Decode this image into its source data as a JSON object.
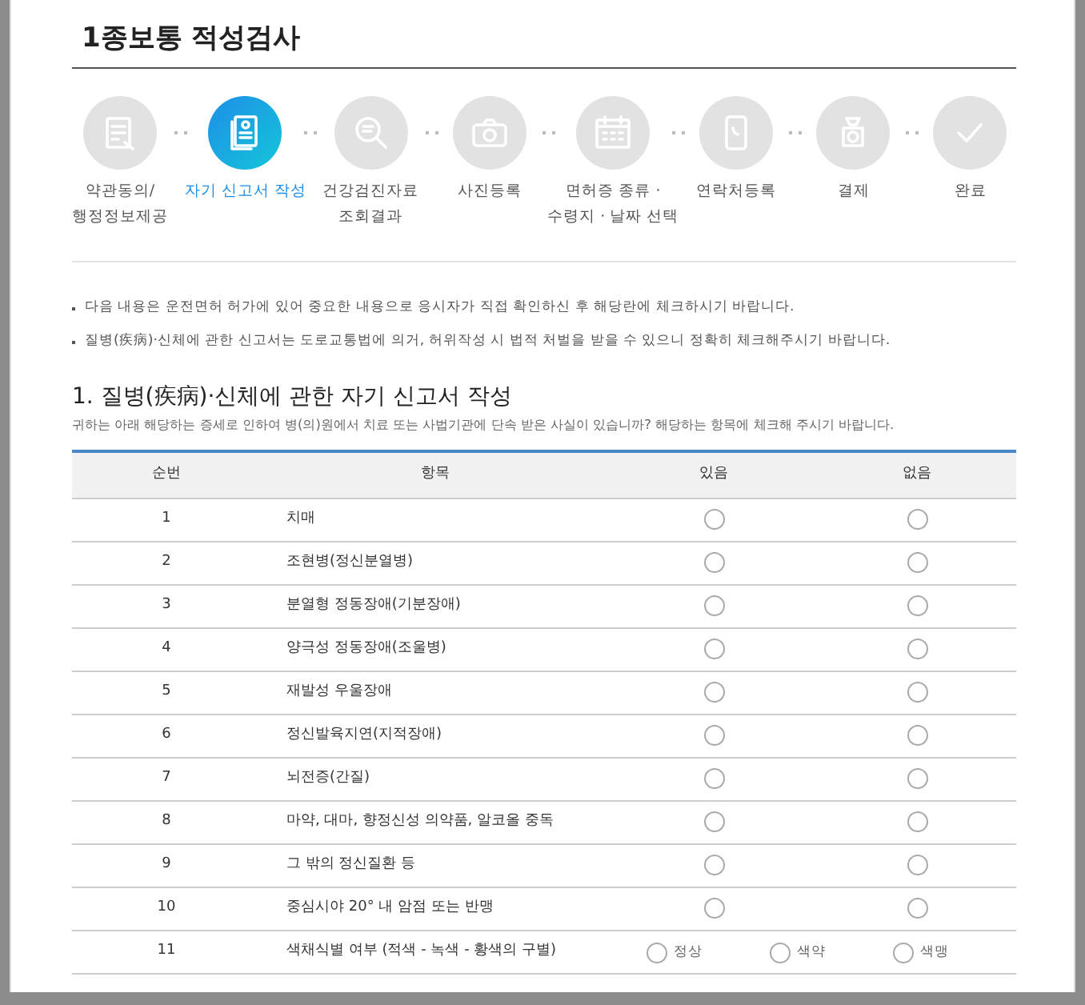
{
  "title": "1종보통 적성검사",
  "steps": [
    {
      "lines": [
        "약관동의/",
        "행정정보제공"
      ],
      "selected": false
    },
    {
      "lines": [
        "자기 신고서 작성"
      ],
      "selected": true
    },
    {
      "lines": [
        "건강검진자료",
        "조회결과"
      ],
      "selected": false
    },
    {
      "lines": [
        "사진등록"
      ],
      "selected": false
    },
    {
      "lines": [
        "면허증 종류 ·",
        "수령지 · 날짜 선택"
      ],
      "selected": false
    },
    {
      "lines": [
        "연락처등록"
      ],
      "selected": false
    },
    {
      "lines": [
        "결제"
      ],
      "selected": false
    },
    {
      "lines": [
        "완료"
      ],
      "selected": false
    }
  ],
  "notices": [
    "다음 내용은 운전면허 허가에 있어 중요한 내용으로 응시자가 직접 확인하신 후 해당란에 체크하시기 바랍니다.",
    "질병(疾病)·신체에 관한 신고서는 도로교통법에 의거, 허위작성 시 법적 처벌을 받을 수 있으니 정확히 체크해주시기 바랍니다."
  ],
  "section": {
    "heading": "1. 질병(疾病)·신체에 관한 자기 신고서 작성",
    "description": "귀하는 아래 해당하는 증세로 인하여 병(의)원에서 치료 또는 사법기관에 단속 받은 사실이 있습니까? 해당하는 항목에 체크해 주시기 바랍니다."
  },
  "table": {
    "columns": [
      "순번",
      "항목",
      "있음",
      "없음"
    ],
    "rows": [
      {
        "kind": "yesno",
        "no": "1",
        "item": "치매",
        "options": [
          {
            "selected": false
          },
          {
            "selected": false
          }
        ]
      },
      {
        "kind": "yesno",
        "no": "2",
        "item": "조현병(정신분열병)",
        "options": [
          {
            "selected": false
          },
          {
            "selected": false
          }
        ]
      },
      {
        "kind": "yesno",
        "no": "3",
        "item": "분열형 정동장애(기분장애)",
        "options": [
          {
            "selected": false
          },
          {
            "selected": false
          }
        ]
      },
      {
        "kind": "yesno",
        "no": "4",
        "item": "양극성 정동장애(조울병)",
        "options": [
          {
            "selected": false
          },
          {
            "selected": false
          }
        ]
      },
      {
        "kind": "yesno",
        "no": "5",
        "item": "재발성 우울장애",
        "options": [
          {
            "selected": false
          },
          {
            "selected": false
          }
        ]
      },
      {
        "kind": "yesno",
        "no": "6",
        "item": "정신발육지연(지적장애)",
        "options": [
          {
            "selected": false
          },
          {
            "selected": false
          }
        ]
      },
      {
        "kind": "yesno",
        "no": "7",
        "item": "뇌전증(간질)",
        "options": [
          {
            "selected": false
          },
          {
            "selected": false
          }
        ]
      },
      {
        "kind": "yesno",
        "no": "8",
        "item": "마약, 대마, 향정신성 의약품, 알코올 중독",
        "options": [
          {
            "selected": false
          },
          {
            "selected": false
          }
        ]
      },
      {
        "kind": "yesno",
        "no": "9",
        "item": "그 밖의 정신질환 등",
        "options": [
          {
            "selected": false
          },
          {
            "selected": false
          }
        ]
      },
      {
        "kind": "yesno",
        "no": "10",
        "item": "중심시야 20° 내 암점 또는 반맹",
        "options": [
          {
            "selected": false
          },
          {
            "selected": false
          }
        ]
      },
      {
        "kind": "labeled",
        "no": "11",
        "item": "색채식별 여부 (적색 - 녹색 - 황색의 구별)",
        "options": [
          {
            "label": "정상",
            "selected": false
          },
          {
            "label": "색약",
            "selected": false
          },
          {
            "label": "색맹",
            "selected": false
          }
        ]
      }
    ]
  }
}
